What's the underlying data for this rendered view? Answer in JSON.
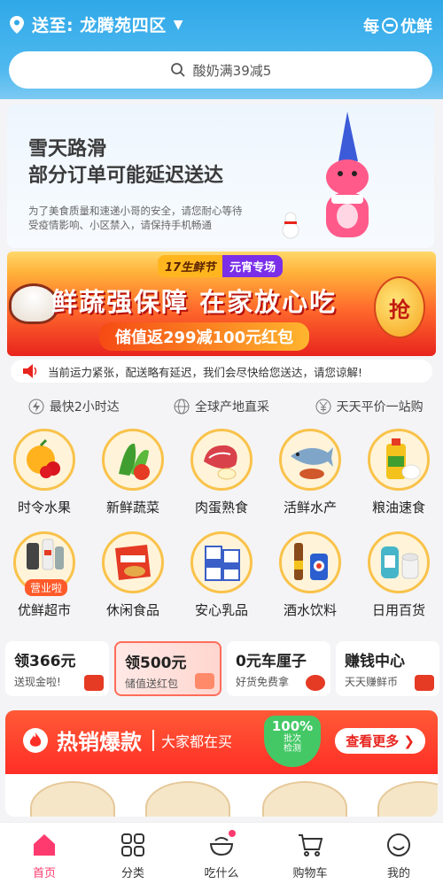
{
  "location": {
    "label": "送至: 龙腾苑四区"
  },
  "brand": {
    "name": "每日优鲜",
    "left": "每",
    "right": "优鲜"
  },
  "search": {
    "placeholder": "酸奶满39减5"
  },
  "notice": {
    "line1": "雪天路滑",
    "line2": "部分订单可能延迟送达",
    "sub1": "为了美食质量和速递小哥的安全，请您耐心等待",
    "sub2": "受疫情影响、小区禁入，请保持手机畅通"
  },
  "promo": {
    "tag_left": "17生鲜节",
    "tag_right": "元宵专场",
    "headline": "鲜蔬强保障 在家放心吃",
    "subline": "储值返299减100元红包",
    "lantern": "抢"
  },
  "delay_notice": "当前运力紧张，配送略有延迟，我们会尽快给您送达，请您谅解!",
  "features": [
    "最快2小时达",
    "全球产地直采",
    "天天平价一站购"
  ],
  "categories": [
    {
      "label": "时令水果",
      "icon": "fruit-icon"
    },
    {
      "label": "新鲜蔬菜",
      "icon": "vegetable-icon"
    },
    {
      "label": "肉蛋熟食",
      "icon": "meat-icon"
    },
    {
      "label": "活鲜水产",
      "icon": "seafood-icon"
    },
    {
      "label": "粮油速食",
      "icon": "grain-oil-icon"
    },
    {
      "label": "优鲜超市",
      "icon": "supermarket-icon"
    },
    {
      "label": "休闲食品",
      "icon": "snack-icon"
    },
    {
      "label": "安心乳品",
      "icon": "dairy-icon"
    },
    {
      "label": "酒水饮料",
      "icon": "drinks-icon"
    },
    {
      "label": "日用百货",
      "icon": "daily-goods-icon"
    }
  ],
  "category_badge": "营业啦",
  "cards": [
    {
      "title": "领366元",
      "sub": "送现金啦!"
    },
    {
      "title": "领500元",
      "sub": "储值送红包"
    },
    {
      "title": "0元车厘子",
      "sub": "好货免费拿"
    },
    {
      "title": "赚钱中心",
      "sub": "天天赚鲜币"
    }
  ],
  "hot": {
    "title": "热销爆款",
    "sub": "大家都在买",
    "shield_pct": "100%",
    "shield_l1": "批次",
    "shield_l2": "检测",
    "more": "查看更多"
  },
  "tabs": [
    {
      "label": "首页",
      "icon": "home-icon"
    },
    {
      "label": "分类",
      "icon": "category-icon"
    },
    {
      "label": "吃什么",
      "icon": "bowl-icon"
    },
    {
      "label": "购物车",
      "icon": "cart-icon"
    },
    {
      "label": "我的",
      "icon": "profile-icon"
    }
  ],
  "colors": {
    "primary": "#2fa8e8",
    "accent": "#ff3a6e",
    "promo_red": "#e8241e"
  }
}
